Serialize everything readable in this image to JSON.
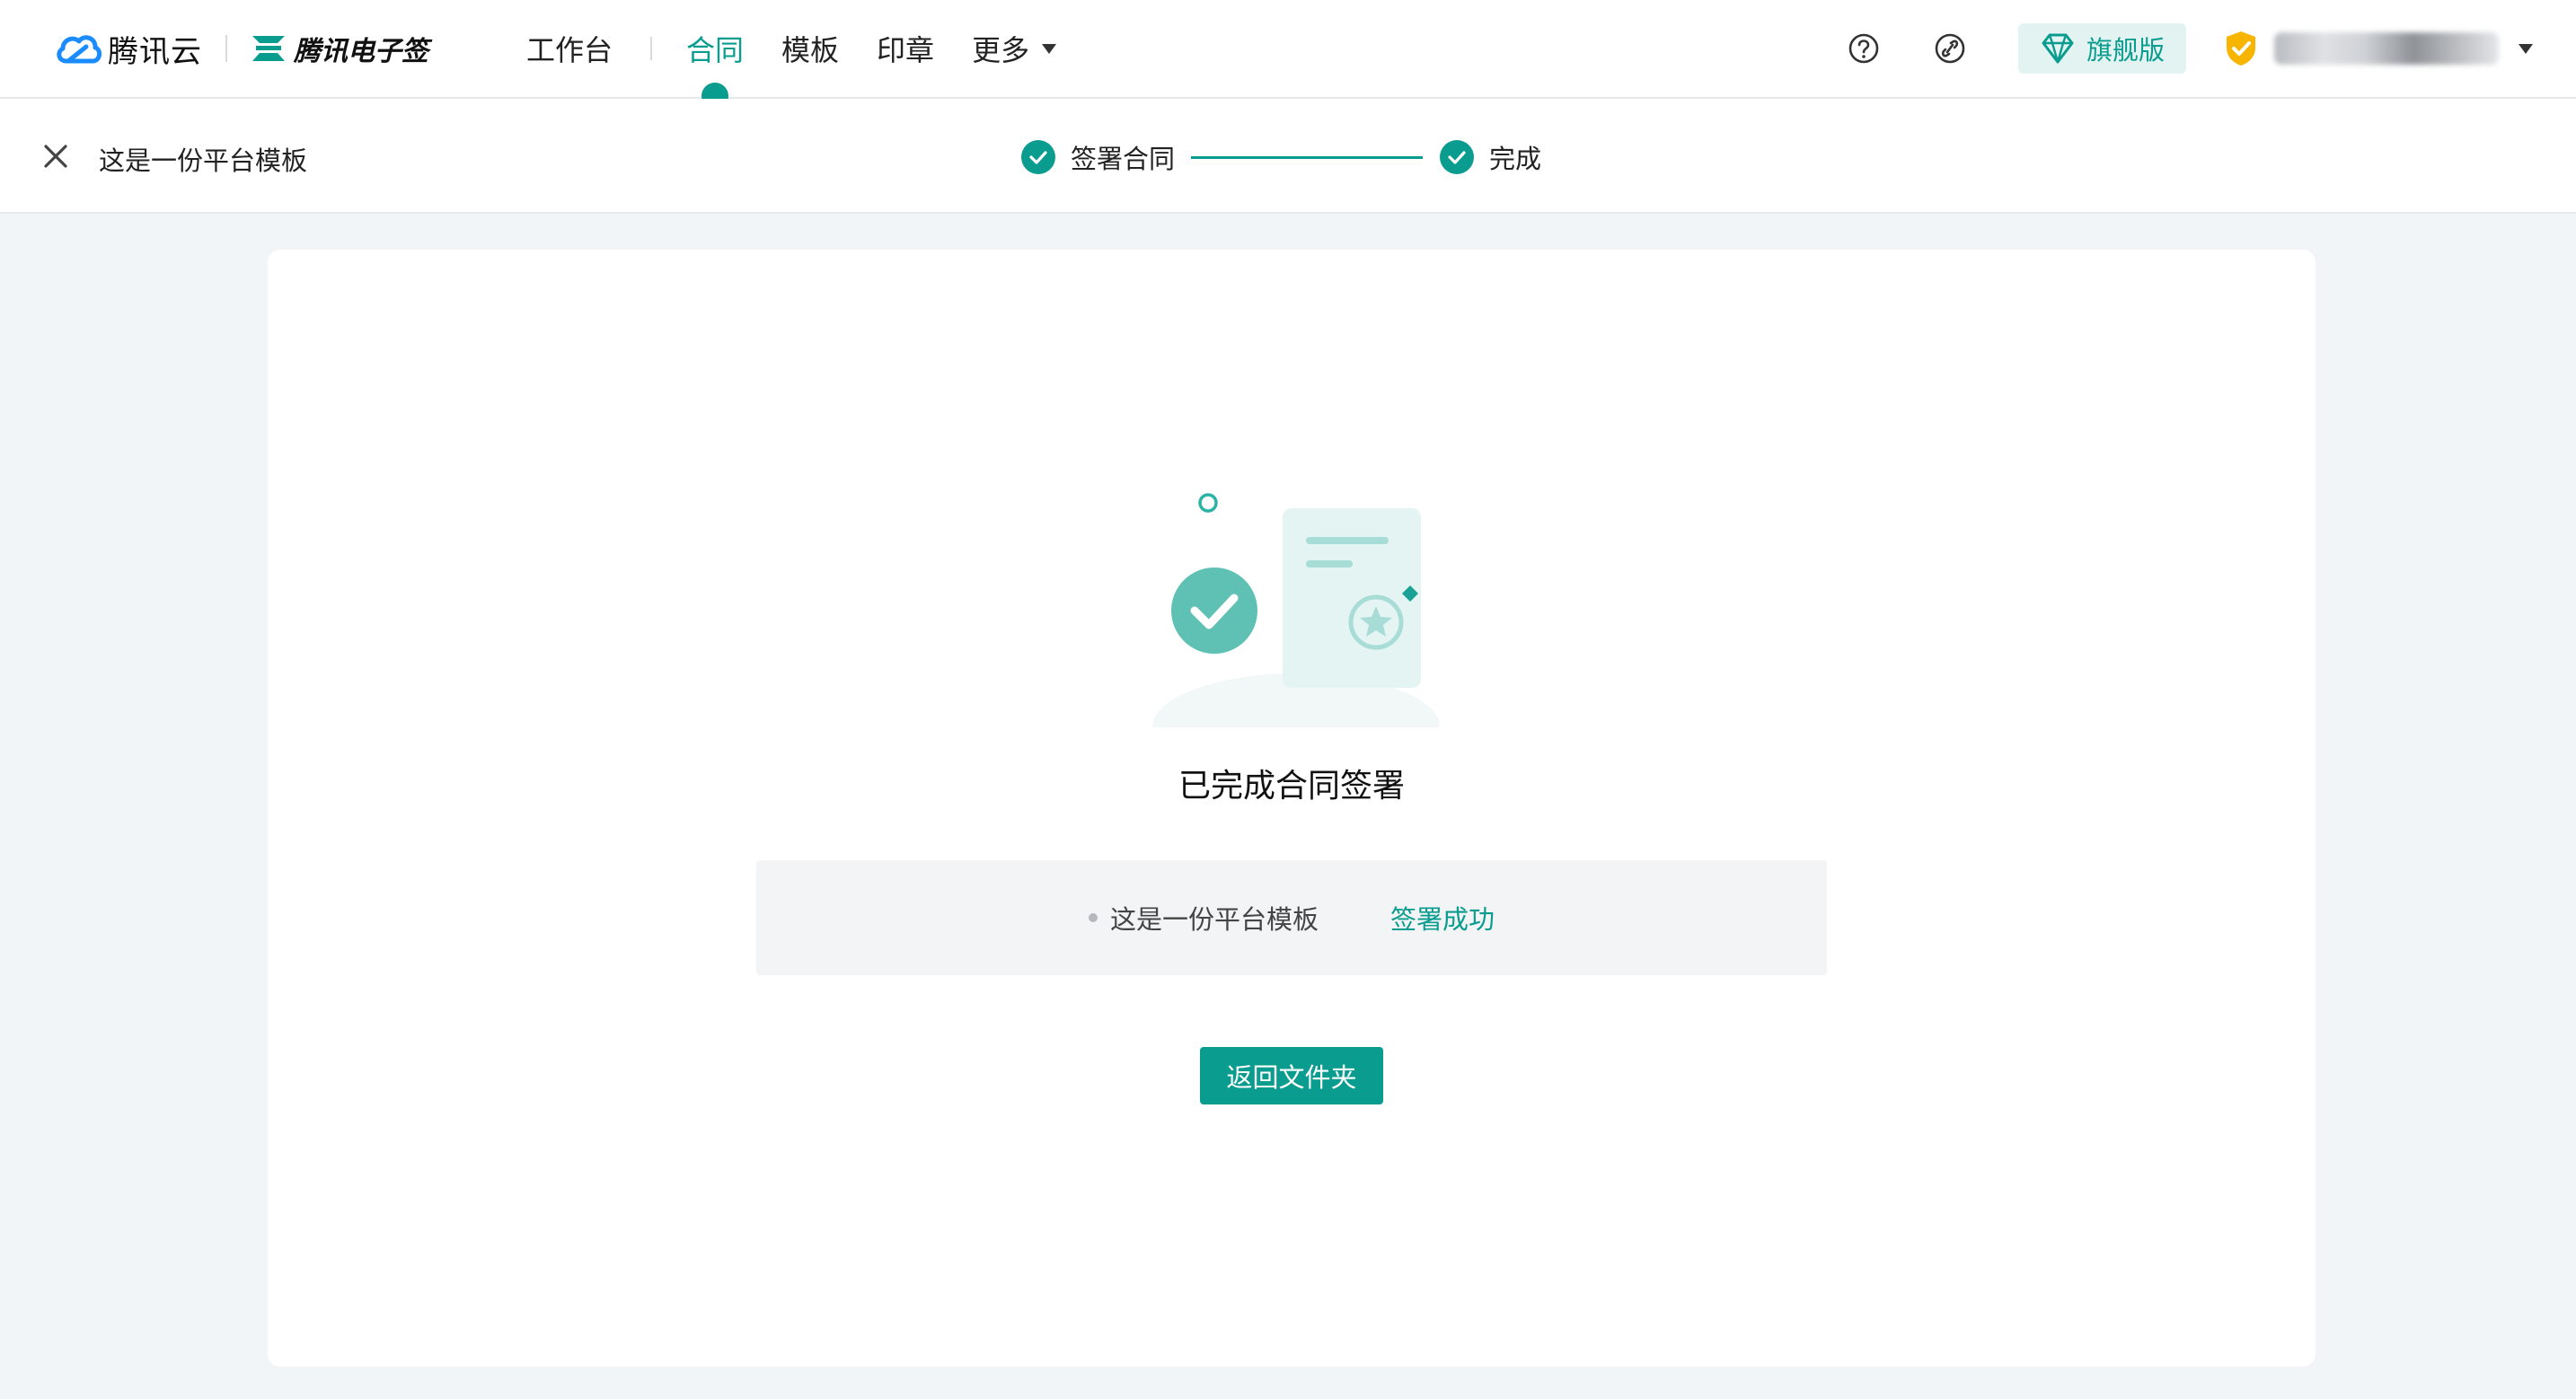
{
  "brand": {
    "cloud_name": "腾讯云",
    "product_name": "腾讯电子签",
    "accent_color": "#0a9c8f"
  },
  "nav": {
    "items": [
      {
        "label": "工作台",
        "active": false
      },
      {
        "label": "合同",
        "active": true
      },
      {
        "label": "模板",
        "active": false
      },
      {
        "label": "印章",
        "active": false
      },
      {
        "label": "更多",
        "active": false,
        "has_dropdown": true
      }
    ]
  },
  "header_tools": {
    "help_icon": "question-circle-icon",
    "link_icon": "link-icon",
    "plan_label": "旗舰版",
    "plan_icon": "diamond-icon",
    "verified_icon": "shield-check-icon",
    "user_name": "██████████"
  },
  "stepbar": {
    "document_title": "这是一份平台模板",
    "steps": [
      {
        "label": "签署合同",
        "done": true
      },
      {
        "label": "完成",
        "done": true
      }
    ]
  },
  "result": {
    "title": "已完成合同签署",
    "file_name": "这是一份平台模板",
    "file_status": "签署成功",
    "back_button": "返回文件夹"
  }
}
